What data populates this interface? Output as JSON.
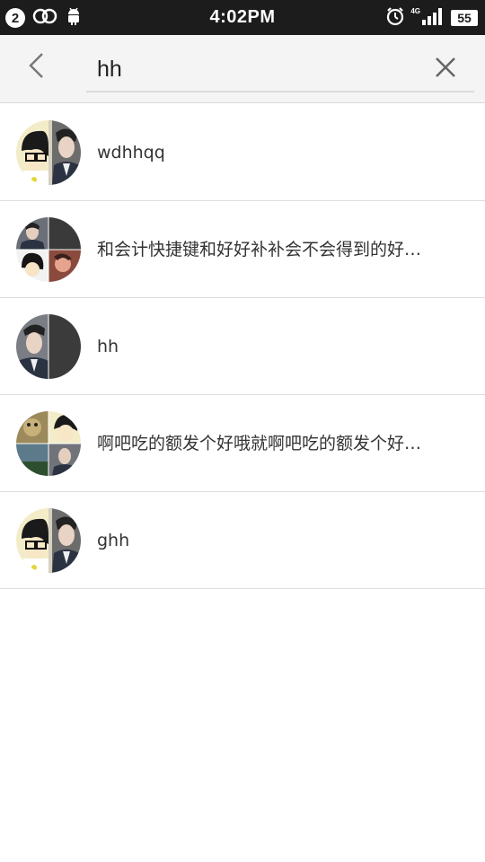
{
  "status_bar": {
    "notification_count": "2",
    "time": "4:02PM",
    "network": "4G",
    "battery": "55",
    "icons": [
      "link-icon",
      "android-icon",
      "alarm-icon",
      "signal-icon",
      "battery-icon"
    ]
  },
  "search": {
    "query": "hh",
    "back_icon": "chevron-left-icon",
    "clear_icon": "close-icon"
  },
  "results": [
    {
      "label": "wdhhqq",
      "avatar": "group-avatar-2"
    },
    {
      "label": "和会计快捷键和好好补补会不会得到的好…",
      "avatar": "group-avatar-4"
    },
    {
      "label": "hh",
      "avatar": "group-avatar-2"
    },
    {
      "label": "啊吧吃的额发个好哦就啊吧吃的额发个好…",
      "avatar": "group-avatar-4"
    },
    {
      "label": "ghh",
      "avatar": "group-avatar-2"
    }
  ],
  "colors": {
    "status_bar_bg": "#1c1c1c",
    "header_bg": "#f4f4f4",
    "divider": "#dedede",
    "text": "#333333"
  }
}
